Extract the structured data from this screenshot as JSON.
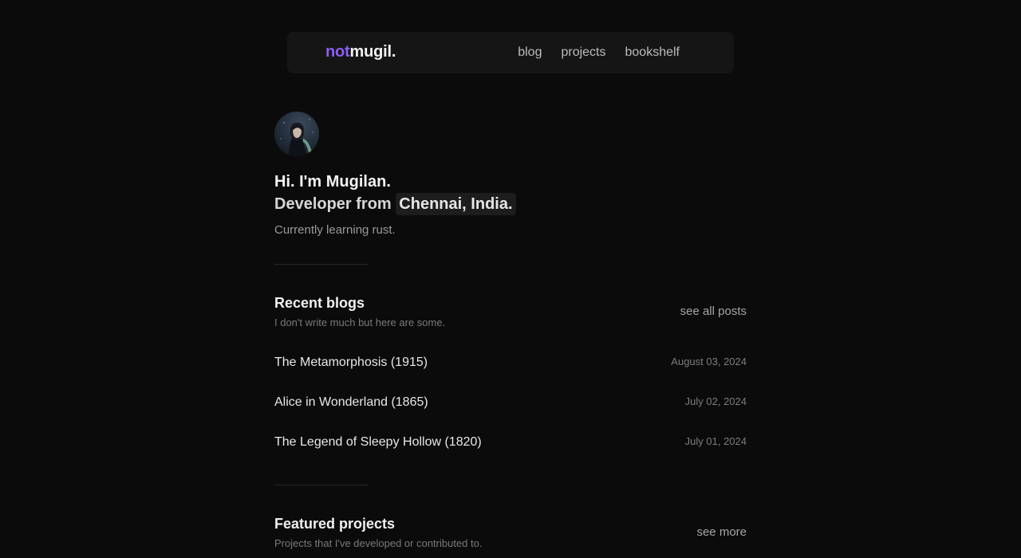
{
  "nav": {
    "logo_accent": "not",
    "logo_main": "mugil.",
    "links": [
      "blog",
      "projects",
      "bookshelf"
    ]
  },
  "hero": {
    "greeting": "Hi. I'm Mugilan.",
    "developer_prefix": "Developer from",
    "location": "Chennai, India.",
    "learning": "Currently learning rust."
  },
  "recent_blogs": {
    "title": "Recent blogs",
    "subtitle": "I don't write much but here are some.",
    "see_all": "see all posts",
    "posts": [
      {
        "title": "The Metamorphosis (1915)",
        "date": "August 03, 2024"
      },
      {
        "title": "Alice in Wonderland (1865)",
        "date": "July 02, 2024"
      },
      {
        "title": "The Legend of Sleepy Hollow (1820)",
        "date": "July 01, 2024"
      }
    ]
  },
  "featured_projects": {
    "title": "Featured projects",
    "subtitle": "Projects that I've developed or contributed to.",
    "see_more": "see more"
  },
  "colors": {
    "background": "#0b0b0b",
    "nav_background": "#151515",
    "accent": "#8b5cf6"
  }
}
